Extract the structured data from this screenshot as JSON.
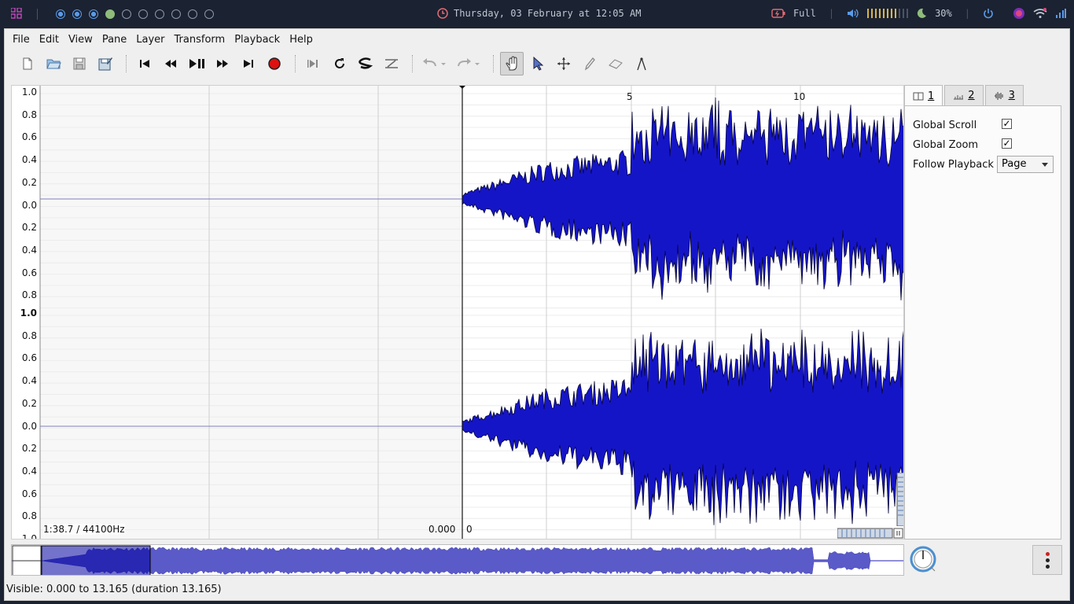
{
  "system_bar": {
    "workspace_dots": [
      "active",
      "active",
      "active",
      "filled",
      "empty",
      "empty",
      "empty",
      "empty",
      "empty",
      "empty"
    ],
    "clock": "Thursday, 03 February at 12:05 AM",
    "battery_label": "Full",
    "brightness": "30%",
    "volume_level": 0.6
  },
  "menubar": {
    "items": [
      "File",
      "Edit",
      "View",
      "Pane",
      "Layer",
      "Transform",
      "Playback",
      "Help"
    ]
  },
  "toolbar": {
    "icons": [
      "new-session-icon",
      "open-icon",
      "save-icon",
      "save-as-icon",
      "rewind-start-icon",
      "rewind-icon",
      "play-pause-icon",
      "fast-forward-icon",
      "fast-forward-end-icon",
      "record-icon",
      "constrain-playback-icon",
      "loop-icon",
      "solo-icon",
      "speed-icon",
      "undo-icon",
      "redo-icon",
      "navigate-icon",
      "select-icon",
      "move-icon",
      "draw-icon",
      "erase-icon",
      "measure-icon"
    ]
  },
  "pane": {
    "y_axis_top": [
      "1.0",
      "0.8",
      "0.6",
      "0.4",
      "0.2",
      "0.0",
      "0.2",
      "0.4",
      "0.6",
      "0.8"
    ],
    "y_axis_bottom": [
      "1.0",
      "0.8",
      "0.6",
      "0.4",
      "0.2",
      "0.0",
      "0.2",
      "0.4",
      "0.6",
      "0.8",
      "1.0"
    ],
    "x_axis_labels": [
      "5",
      "10"
    ],
    "duration_rate": "1:38.7 / 44100Hz",
    "cursor_time": "0.000",
    "cursor_frame": "0",
    "waveform_color": "#1515c8",
    "waveform_outline": "#06063a"
  },
  "properties": {
    "tabs": [
      "1",
      "2",
      "3"
    ],
    "global_scroll_label": "Global Scroll",
    "global_scroll_checked": "✓",
    "global_zoom_label": "Global Zoom",
    "global_zoom_checked": "✓",
    "follow_playback_label": "Follow Playback",
    "follow_playback_value": "Page"
  },
  "statusbar": {
    "visible_text": "Visible: 0.000 to 13.165 (duration 13.165)"
  }
}
